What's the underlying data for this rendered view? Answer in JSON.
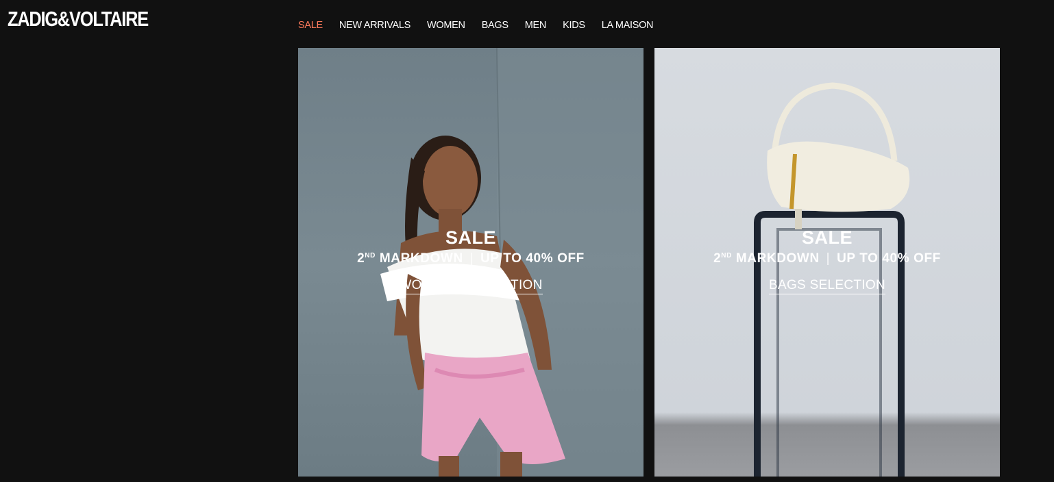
{
  "brand": {
    "logo_text": "ZADIG&VOLTAIRE"
  },
  "nav": {
    "items": [
      {
        "label": "SALE",
        "active": true
      },
      {
        "label": "NEW ARRIVALS"
      },
      {
        "label": "WOMEN"
      },
      {
        "label": "BAGS"
      },
      {
        "label": "MEN"
      },
      {
        "label": "KIDS"
      },
      {
        "label": "LA MAISON"
      }
    ],
    "active_color": "#ff7b5c"
  },
  "cards": [
    {
      "title": "SALE",
      "markdown_num": "2",
      "markdown_sup": "ND",
      "markdown_text": " MARKDOWN",
      "separator": "|",
      "discount": "UP TO 40% OFF",
      "cta": "WOMEN'S SELECTION"
    },
    {
      "title": "SALE",
      "markdown_num": "2",
      "markdown_sup": "ND",
      "markdown_text": " MARKDOWN",
      "separator": "|",
      "discount": "UP TO 40% OFF",
      "cta": "BAGS SELECTION"
    }
  ]
}
